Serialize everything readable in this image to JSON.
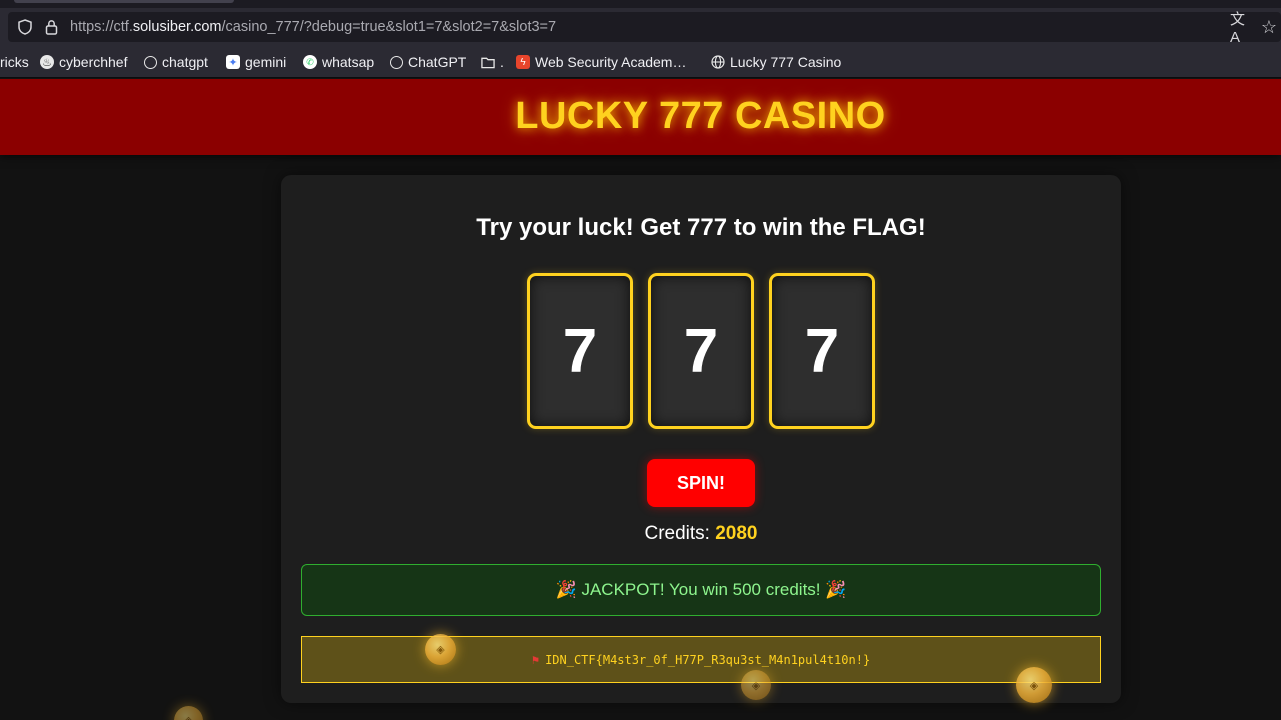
{
  "browser": {
    "url_prefix": "https://ctf.",
    "url_host": "solusiber.com",
    "url_path": "/casino_777/?debug=true&slot1=7&slot2=7&slot3=7"
  },
  "bookmarks": [
    {
      "label": "ricks",
      "icon": ""
    },
    {
      "label": "cyberchhef",
      "icon": "chef-hat-icon"
    },
    {
      "label": "chatgpt",
      "icon": "openai-icon"
    },
    {
      "label": "gemini",
      "icon": "sparkle-icon"
    },
    {
      "label": "whatsap",
      "icon": "whatsapp-icon"
    },
    {
      "label": "ChatGPT",
      "icon": "openai-icon"
    },
    {
      "label": ".",
      "icon": "folder-icon"
    },
    {
      "label": "Web Security Academ…",
      "icon": "portswigger-icon"
    },
    {
      "label": "Lucky 777 Casino",
      "icon": "globe-icon"
    }
  ],
  "site": {
    "title": "LUCKY 777 CASINO"
  },
  "game": {
    "heading": "Try your luck! Get 777 to win the FLAG!",
    "slots": [
      "7",
      "7",
      "7"
    ],
    "spin_label": "SPIN!",
    "credits_label": "Credits: ",
    "credits_value": "2080",
    "jackpot_message": "🎉 JACKPOT! You win 500 credits! 🎉",
    "flag_text": "IDN_CTF{M4st3r_0f_H77P_R3qu3st_M4n1pul4t10n!}"
  },
  "colors": {
    "header_bg": "#8b0000",
    "accent_gold": "#ffd21f",
    "spin_red": "#ff0000",
    "success_green": "#8ef58e"
  }
}
